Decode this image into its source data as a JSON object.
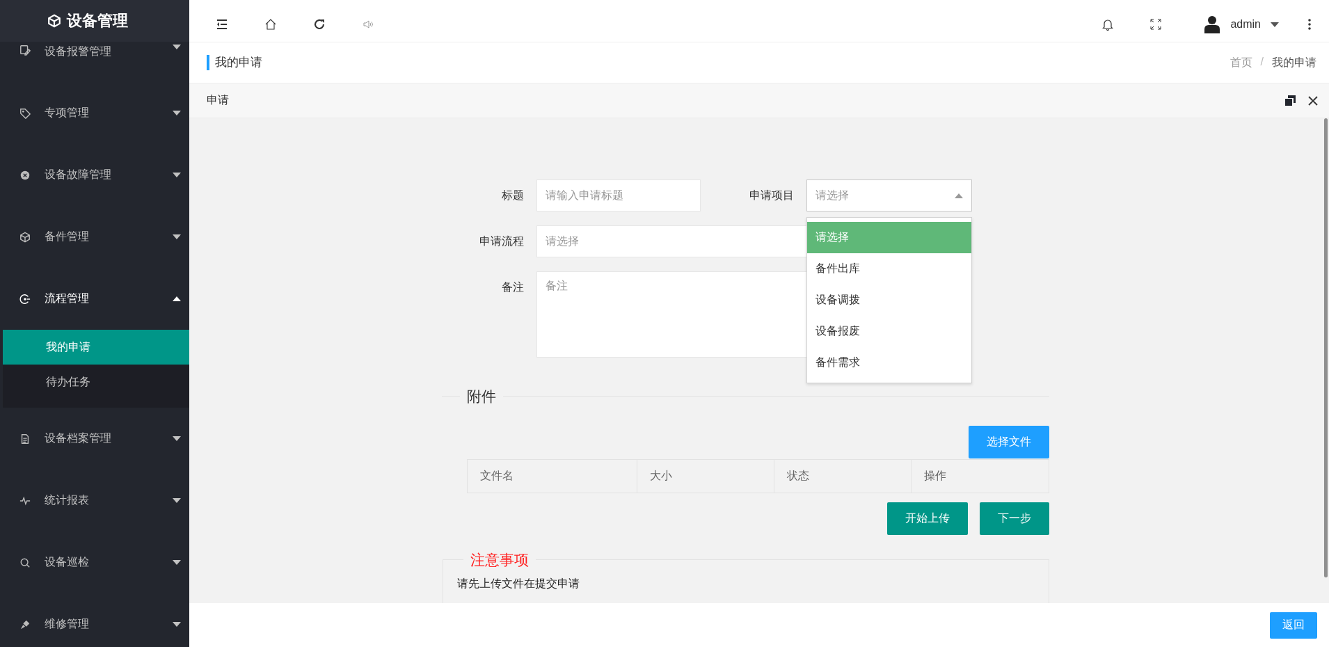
{
  "sidebar": {
    "logo": "设备管理",
    "items": [
      {
        "label": "设备报警管理",
        "expanded": false
      },
      {
        "label": "专项管理",
        "expanded": false
      },
      {
        "label": "设备故障管理",
        "expanded": false
      },
      {
        "label": "备件管理",
        "expanded": false
      },
      {
        "label": "流程管理",
        "expanded": true,
        "children": [
          {
            "label": "我的申请",
            "selected": true
          },
          {
            "label": "待办任务",
            "selected": false
          }
        ]
      },
      {
        "label": "设备档案管理",
        "expanded": false
      },
      {
        "label": "统计报表",
        "expanded": false
      },
      {
        "label": "设备巡检",
        "expanded": false
      },
      {
        "label": "维修管理",
        "expanded": false
      }
    ]
  },
  "header": {
    "user": "admin"
  },
  "page_title": "我的申请",
  "breadcrumb": {
    "items": [
      "首页",
      "我的申请"
    ],
    "separator": "/"
  },
  "panel": {
    "title": "申请"
  },
  "form": {
    "rows": [
      [
        {
          "kind": "input",
          "label": "标题",
          "placeholder": "请输入申请标题"
        },
        {
          "kind": "select",
          "label": "申请项目",
          "placeholder": "请选择",
          "expanded": true
        }
      ],
      [
        {
          "kind": "input",
          "label": "申请流程",
          "placeholder": "请选择"
        }
      ],
      [
        {
          "kind": "textarea",
          "label": "备注",
          "placeholder": "备注"
        }
      ]
    ],
    "dropdown": {
      "options": [
        {
          "label": "请选择",
          "selected": true
        },
        {
          "label": "备件出库",
          "selected": false
        },
        {
          "label": "设备调拨",
          "selected": false
        },
        {
          "label": "设备报废",
          "selected": false
        },
        {
          "label": "备件需求",
          "selected": false
        }
      ]
    }
  },
  "attachments": {
    "legend": "附件",
    "choose_button": "选择文件",
    "columns": [
      "文件名",
      "大小",
      "状态",
      "操作"
    ],
    "buttons": [
      "开始上传",
      "下一步"
    ]
  },
  "notice": {
    "legend": "注意事项",
    "text": "请先上传文件在提交申请"
  },
  "footer": {
    "back_button": "返回"
  }
}
